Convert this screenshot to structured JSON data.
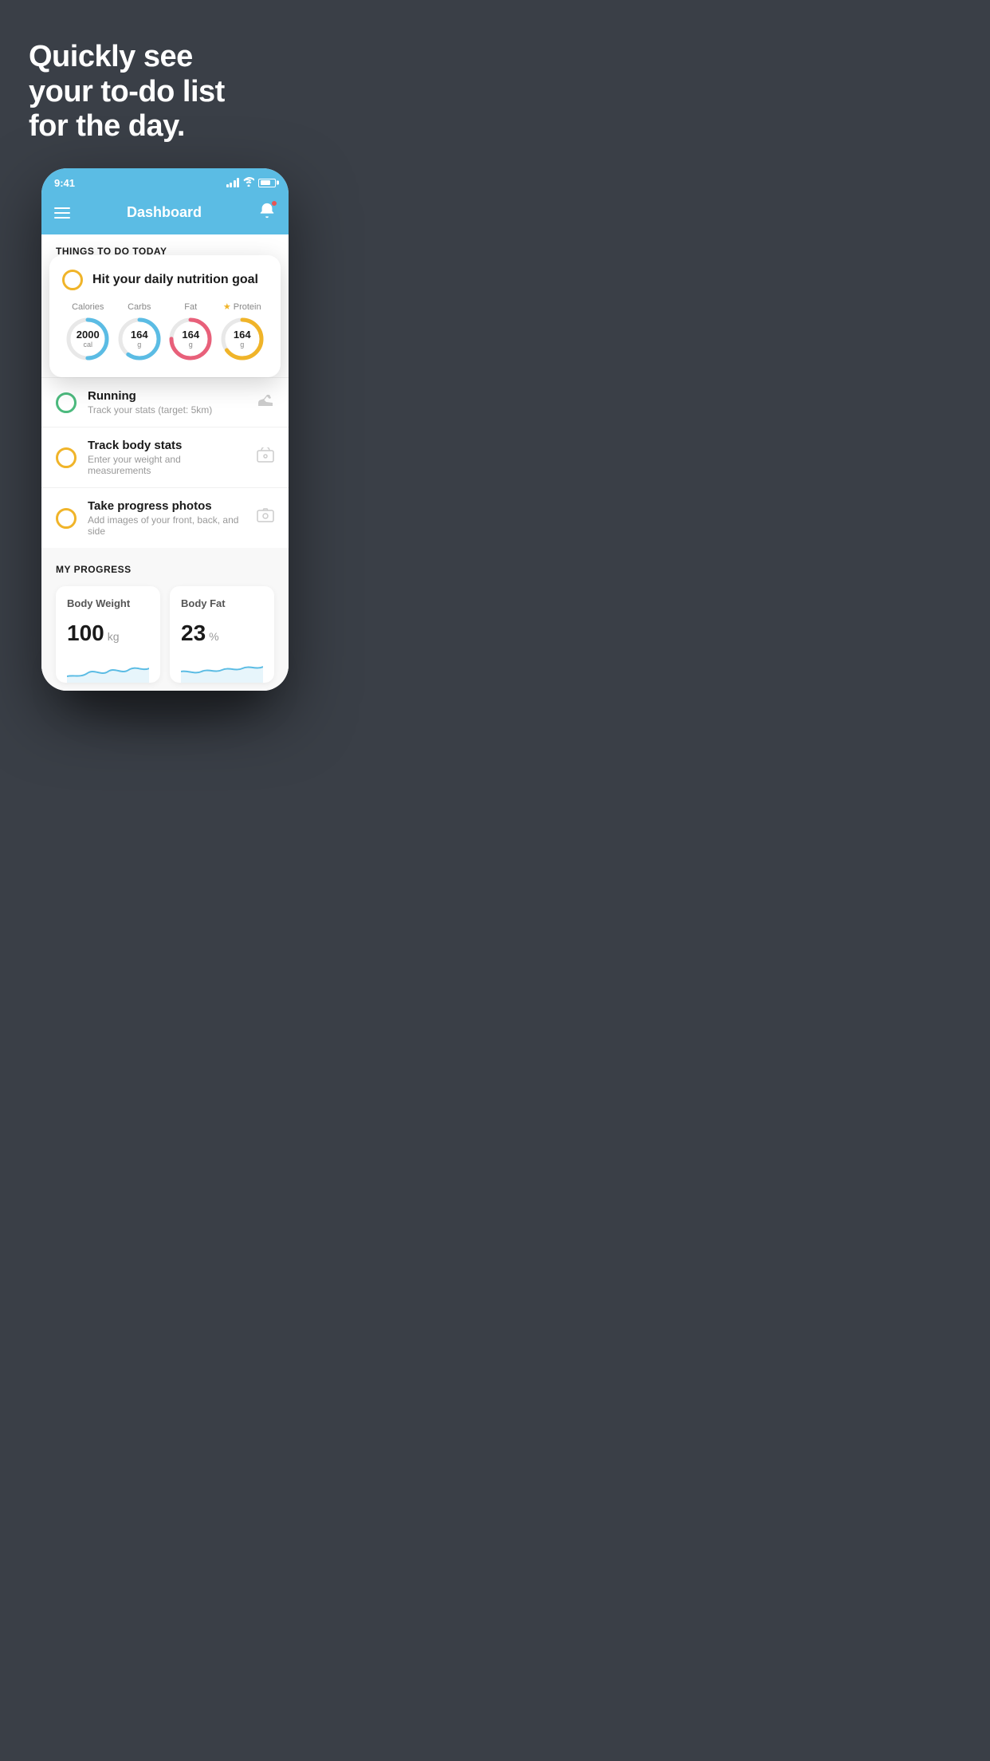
{
  "hero": {
    "line1": "Quickly see",
    "line2": "your to-do list",
    "line3": "for the day."
  },
  "statusBar": {
    "time": "9:41"
  },
  "appHeader": {
    "title": "Dashboard"
  },
  "thingsToDo": {
    "sectionTitle": "THINGS TO DO TODAY"
  },
  "nutritionCard": {
    "title": "Hit your daily nutrition goal",
    "items": [
      {
        "label": "Calories",
        "value": "2000",
        "unit": "cal",
        "color": "#5bbce4",
        "progress": 0.5,
        "starred": false
      },
      {
        "label": "Carbs",
        "value": "164",
        "unit": "g",
        "color": "#5bbce4",
        "progress": 0.6,
        "starred": false
      },
      {
        "label": "Fat",
        "value": "164",
        "unit": "g",
        "color": "#e8607a",
        "progress": 0.75,
        "starred": false
      },
      {
        "label": "Protein",
        "value": "164",
        "unit": "g",
        "color": "#f0b429",
        "progress": 0.65,
        "starred": true
      }
    ]
  },
  "todoItems": [
    {
      "title": "Running",
      "subtitle": "Track your stats (target: 5km)",
      "radioColor": "green",
      "icon": "shoe"
    },
    {
      "title": "Track body stats",
      "subtitle": "Enter your weight and measurements",
      "radioColor": "yellow",
      "icon": "scale"
    },
    {
      "title": "Take progress photos",
      "subtitle": "Add images of your front, back, and side",
      "radioColor": "yellow",
      "icon": "photo"
    }
  ],
  "myProgress": {
    "sectionTitle": "MY PROGRESS",
    "cards": [
      {
        "title": "Body Weight",
        "value": "100",
        "unit": "kg"
      },
      {
        "title": "Body Fat",
        "value": "23",
        "unit": "%"
      }
    ]
  }
}
